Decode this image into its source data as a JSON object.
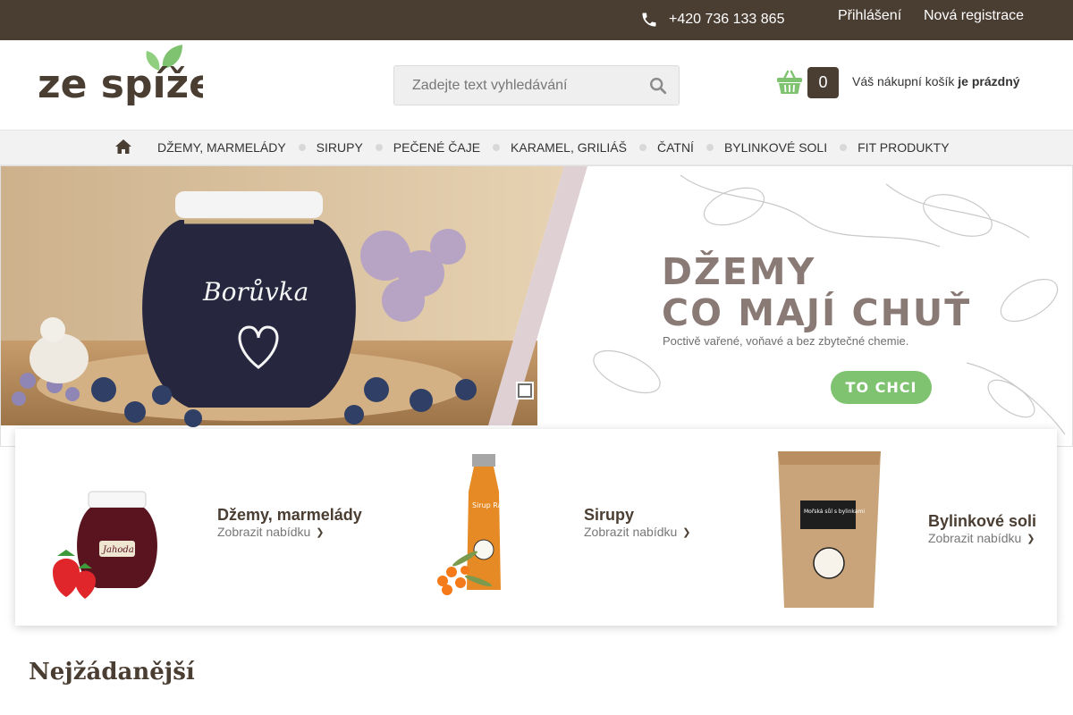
{
  "topbar": {
    "phone": "+420 736 133 865",
    "login": "Přihlášení",
    "register": "Nová registrace"
  },
  "header": {
    "logo_text": "ze spíže",
    "search_placeholder": "Zadejte text vyhledávání",
    "cart_count": "0",
    "cart_text_prefix": "Váš nákupní košík",
    "cart_text_status": "je prázdný"
  },
  "nav": {
    "items": [
      "DŽEMY, MARMELÁDY",
      "SIRUPY",
      "PEČENÉ ČAJE",
      "KARAMEL, GRILIÁŠ",
      "ČATNÍ",
      "BYLINKOVÉ SOLI",
      "FIT PRODUKTY"
    ]
  },
  "banner": {
    "jar_label": "Borůvka",
    "headline_line1": "DŽEMY",
    "headline_line2": "CO MAJÍ CHUŤ",
    "subtitle": "Poctivě vařené, voňavé a bez zbytečné chemie.",
    "cta": "TO CHCI",
    "active_slide": 1,
    "slides": 2
  },
  "categories": [
    {
      "title": "Džemy, marmelády",
      "link": "Zobrazit nabídku",
      "jar_label": "Jahoda"
    },
    {
      "title": "Sirupy",
      "link": "Zobrazit nabídku",
      "bottle_label": "Sirup Rakytník"
    },
    {
      "title": "Bylinkové soli",
      "link": "Zobrazit nabídku",
      "bag_label": "Mořská sůl s bylinkami"
    }
  ],
  "section": {
    "title": "Nejžádanější"
  },
  "colors": {
    "brown": "#4a3d32",
    "green": "#7fc371",
    "nav_bg": "#f2f2f2"
  }
}
